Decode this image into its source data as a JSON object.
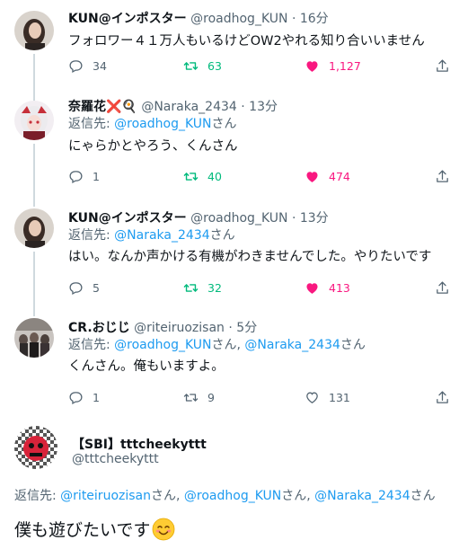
{
  "tweets": [
    {
      "name": "KUN@インポスター",
      "handle": "@roadhog_KUN",
      "time": "16分",
      "reply_prefix": "",
      "reply_targets": [],
      "text": "フォロワー４１万人もいるけどOW2やれる知り合いいません",
      "stats": {
        "replies": "34",
        "retweets": "63",
        "likes": "1,127"
      },
      "retweeted": true,
      "liked": true
    },
    {
      "name": "奈羅花❌🍳",
      "handle": "@Naraka_2434",
      "time": "13分",
      "reply_prefix": "返信先: ",
      "reply_targets": [
        "@roadhog_KUN"
      ],
      "reply_suffix": "さん",
      "text": "にゃらかとやろう、くんさん",
      "stats": {
        "replies": "1",
        "retweets": "40",
        "likes": "474"
      },
      "retweeted": true,
      "liked": true
    },
    {
      "name": "KUN@インポスター",
      "handle": "@roadhog_KUN",
      "time": "13分",
      "reply_prefix": "返信先: ",
      "reply_targets": [
        "@Naraka_2434"
      ],
      "reply_suffix": "さん",
      "text": "はい。なんか声かける有機がわきませんでした。やりたいです",
      "stats": {
        "replies": "5",
        "retweets": "32",
        "likes": "413"
      },
      "retweeted": true,
      "liked": true
    },
    {
      "name": "CR.おじじ",
      "handle": "@riteiruozisan",
      "time": "5分",
      "reply_prefix": "返信先: ",
      "reply_targets": [
        "@roadhog_KUN",
        "@Naraka_2434"
      ],
      "reply_suffix": "さん",
      "text": "くんさん。俺もいますよ。",
      "stats": {
        "replies": "1",
        "retweets": "9",
        "likes": "131"
      },
      "retweeted": false,
      "liked": false
    }
  ],
  "main_tweet": {
    "name": "【SBI】tttcheekyttt",
    "handle": "@tttcheekyttt",
    "reply_prefix": "返信先: ",
    "reply_1": "@riteiruozisan",
    "reply_2": "@roadhog_KUN",
    "reply_3": "@Naraka_2434",
    "san": "さん",
    "sep": ", ",
    "text": "僕も遊びたいです",
    "emoji": "smiling-face-emoji"
  },
  "colors": {
    "link": "#1d9bf0",
    "retweet_active": "#00ba7c",
    "like_active": "#f91880",
    "secondary_text": "#536471",
    "thread_line": "#cfd9de"
  },
  "icons": {
    "reply": "reply-icon",
    "retweet": "retweet-icon",
    "like": "heart-icon",
    "share": "share-icon"
  }
}
